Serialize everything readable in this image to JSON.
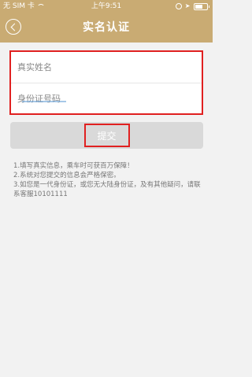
{
  "status_bar": {
    "carrier": "无 SIM 卡",
    "time": "上午9:51"
  },
  "header": {
    "title": "实名认证"
  },
  "form": {
    "name_placeholder": "真实姓名",
    "id_placeholder": "身份证号码"
  },
  "submit_label": "提交",
  "notes": [
    "1.填写真实信息，乘车时可获百万保障！",
    "2.系统对您提交的信息会严格保密。",
    "3.如您是一代身份证，或您无大陆身份证，及有其他疑问，请联系客服10101111"
  ],
  "icons": {
    "wifi": "wifi-icon",
    "location": "location-icon",
    "battery": "battery-icon",
    "back": "back-arrow-icon"
  },
  "colors": {
    "header": "#c9ab73",
    "highlight": "#e02020",
    "button": "#d9d9d9"
  }
}
